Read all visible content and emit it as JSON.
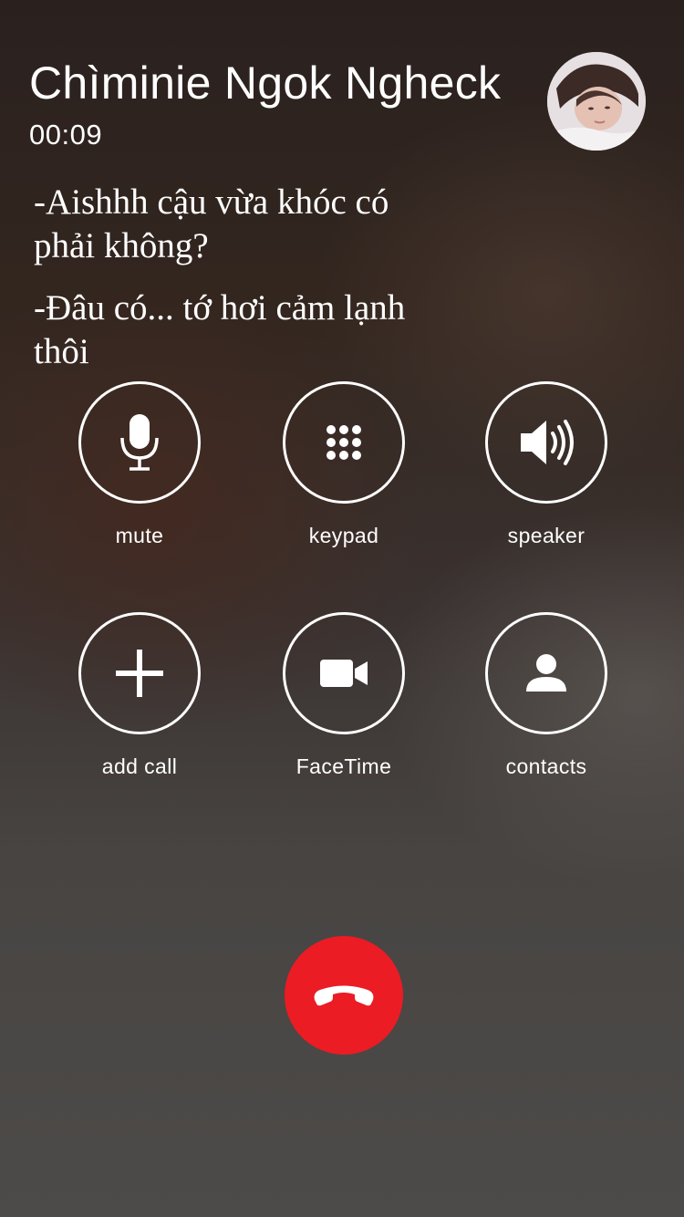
{
  "call": {
    "caller_name": "Chìminie Ngok Ngheck",
    "duration": "00:09"
  },
  "messages": [
    "-Aishhh cậu vừa khóc có phải không?",
    "-Đâu có... tớ hơi cảm lạnh thôi"
  ],
  "controls": {
    "mute": "mute",
    "keypad": "keypad",
    "speaker": "speaker",
    "add_call": "add call",
    "facetime": "FaceTime",
    "contacts": "contacts"
  },
  "icons": {
    "mute": "microphone-icon",
    "keypad": "keypad-grid-icon",
    "speaker": "speaker-icon",
    "add_call": "plus-icon",
    "facetime": "video-camera-icon",
    "contacts": "person-icon",
    "end_call": "phone-hangup-icon"
  },
  "colors": {
    "end_call": "#eb1c24",
    "text": "#ffffff"
  }
}
